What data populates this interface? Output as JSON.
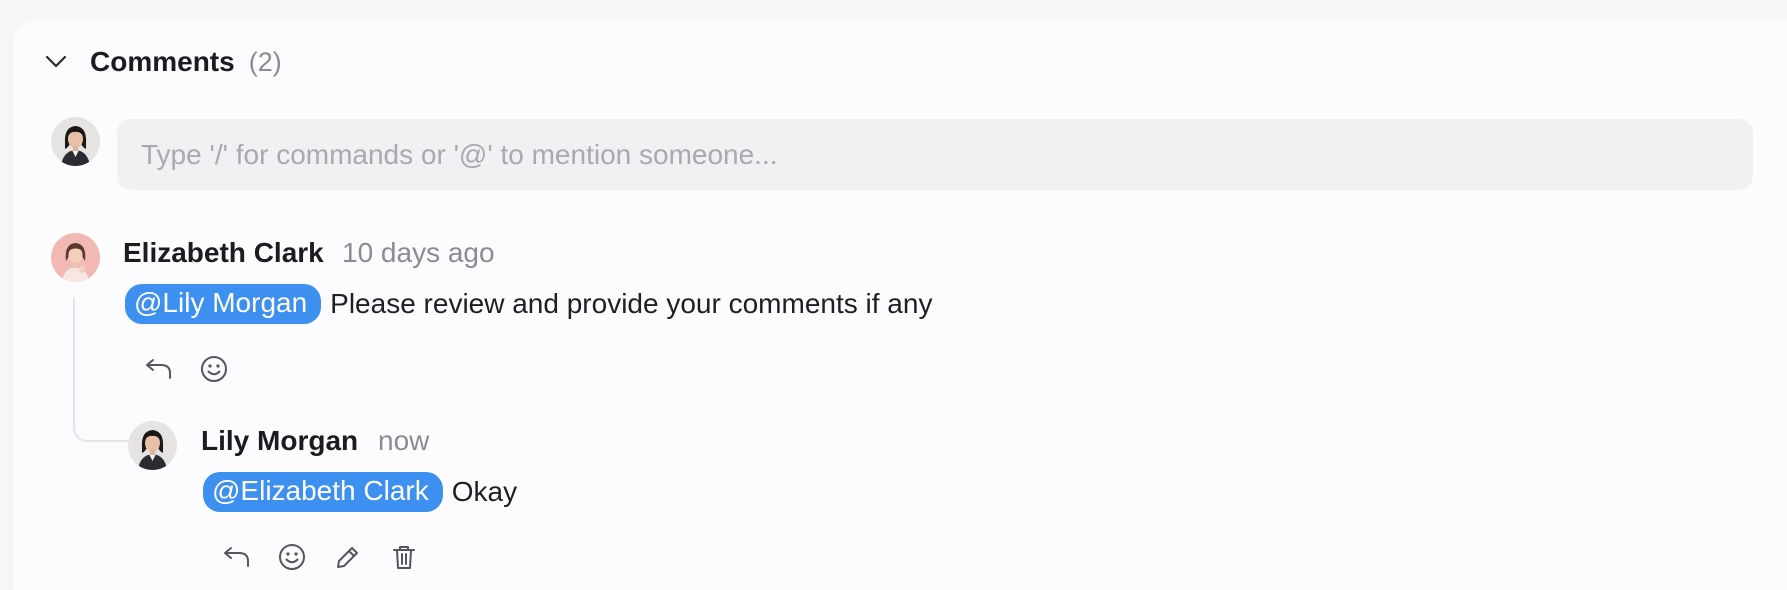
{
  "comments_section": {
    "title": "Comments",
    "count": "(2)"
  },
  "composer": {
    "placeholder": "Type '/' for commands or '@' to mention someone..."
  },
  "comments": [
    {
      "author": "Elizabeth Clark",
      "time": "10 days ago",
      "mention": "@Lily Morgan",
      "text": "Please review and provide your comments if any",
      "actions": [
        "reply-icon",
        "emoji-icon"
      ]
    },
    {
      "author": "Lily Morgan",
      "time": "now",
      "mention": "@Elizabeth Clark",
      "text": "Okay",
      "actions": [
        "reply-icon",
        "emoji-icon",
        "edit-icon",
        "delete-icon"
      ]
    }
  ],
  "colors": {
    "mention_bg": "#3d8ff0",
    "input_bg": "#f1f1f3",
    "muted_text": "#8b8b92"
  }
}
